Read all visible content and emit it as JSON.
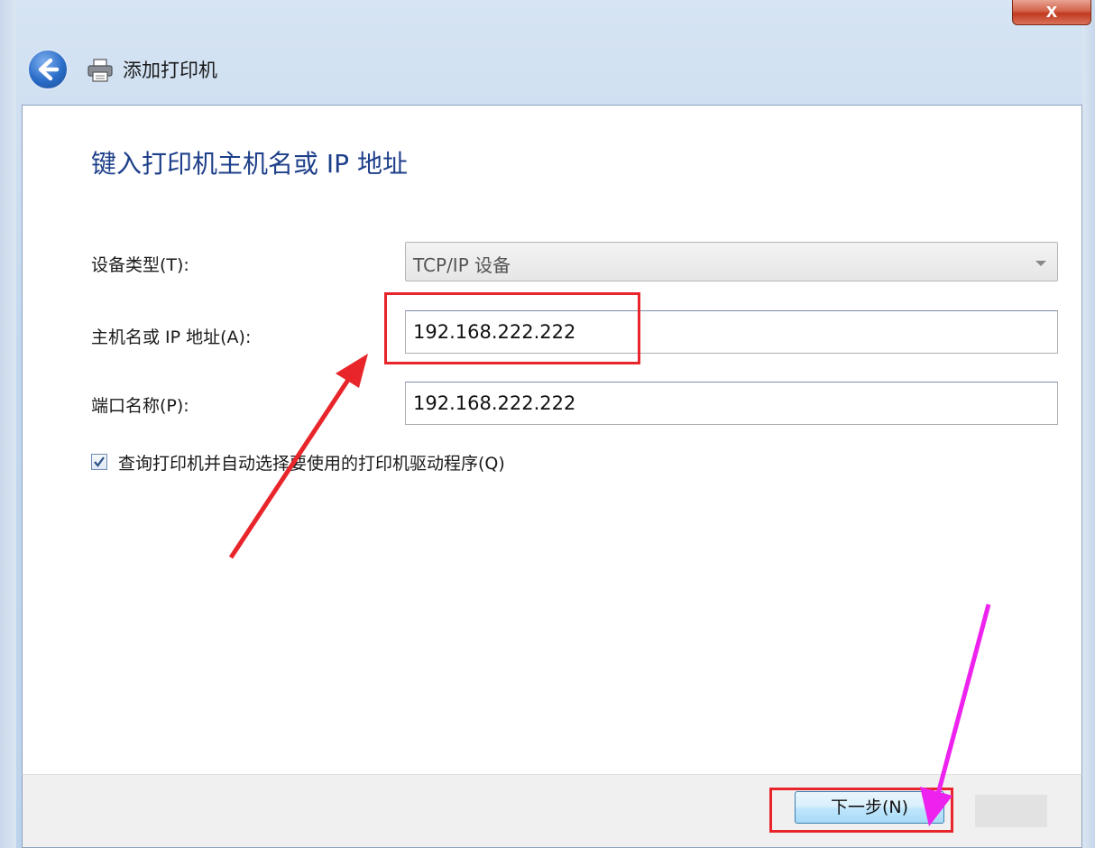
{
  "window": {
    "close_glyph": "x"
  },
  "nav": {
    "title": "添加打印机",
    "back_icon": "back-arrow-icon",
    "printer_icon": "printer-icon"
  },
  "page": {
    "heading": "键入打印机主机名或 IP 地址"
  },
  "form": {
    "device_type_label": "设备类型(T):",
    "device_type_value": "TCP/IP 设备",
    "hostname_label": "主机名或 IP 地址(A):",
    "hostname_value": "192.168.222.222",
    "port_label": "端口名称(P):",
    "port_value": "192.168.222.222",
    "query_checkbox_label": "查询打印机并自动选择要使用的打印机驱动程序(Q)",
    "query_checked": true
  },
  "footer": {
    "next_label": "下一步(N)"
  },
  "colors": {
    "highlight": "#e8252b",
    "magenta_arrow": "#ee22ee",
    "heading": "#1e3f8a"
  }
}
